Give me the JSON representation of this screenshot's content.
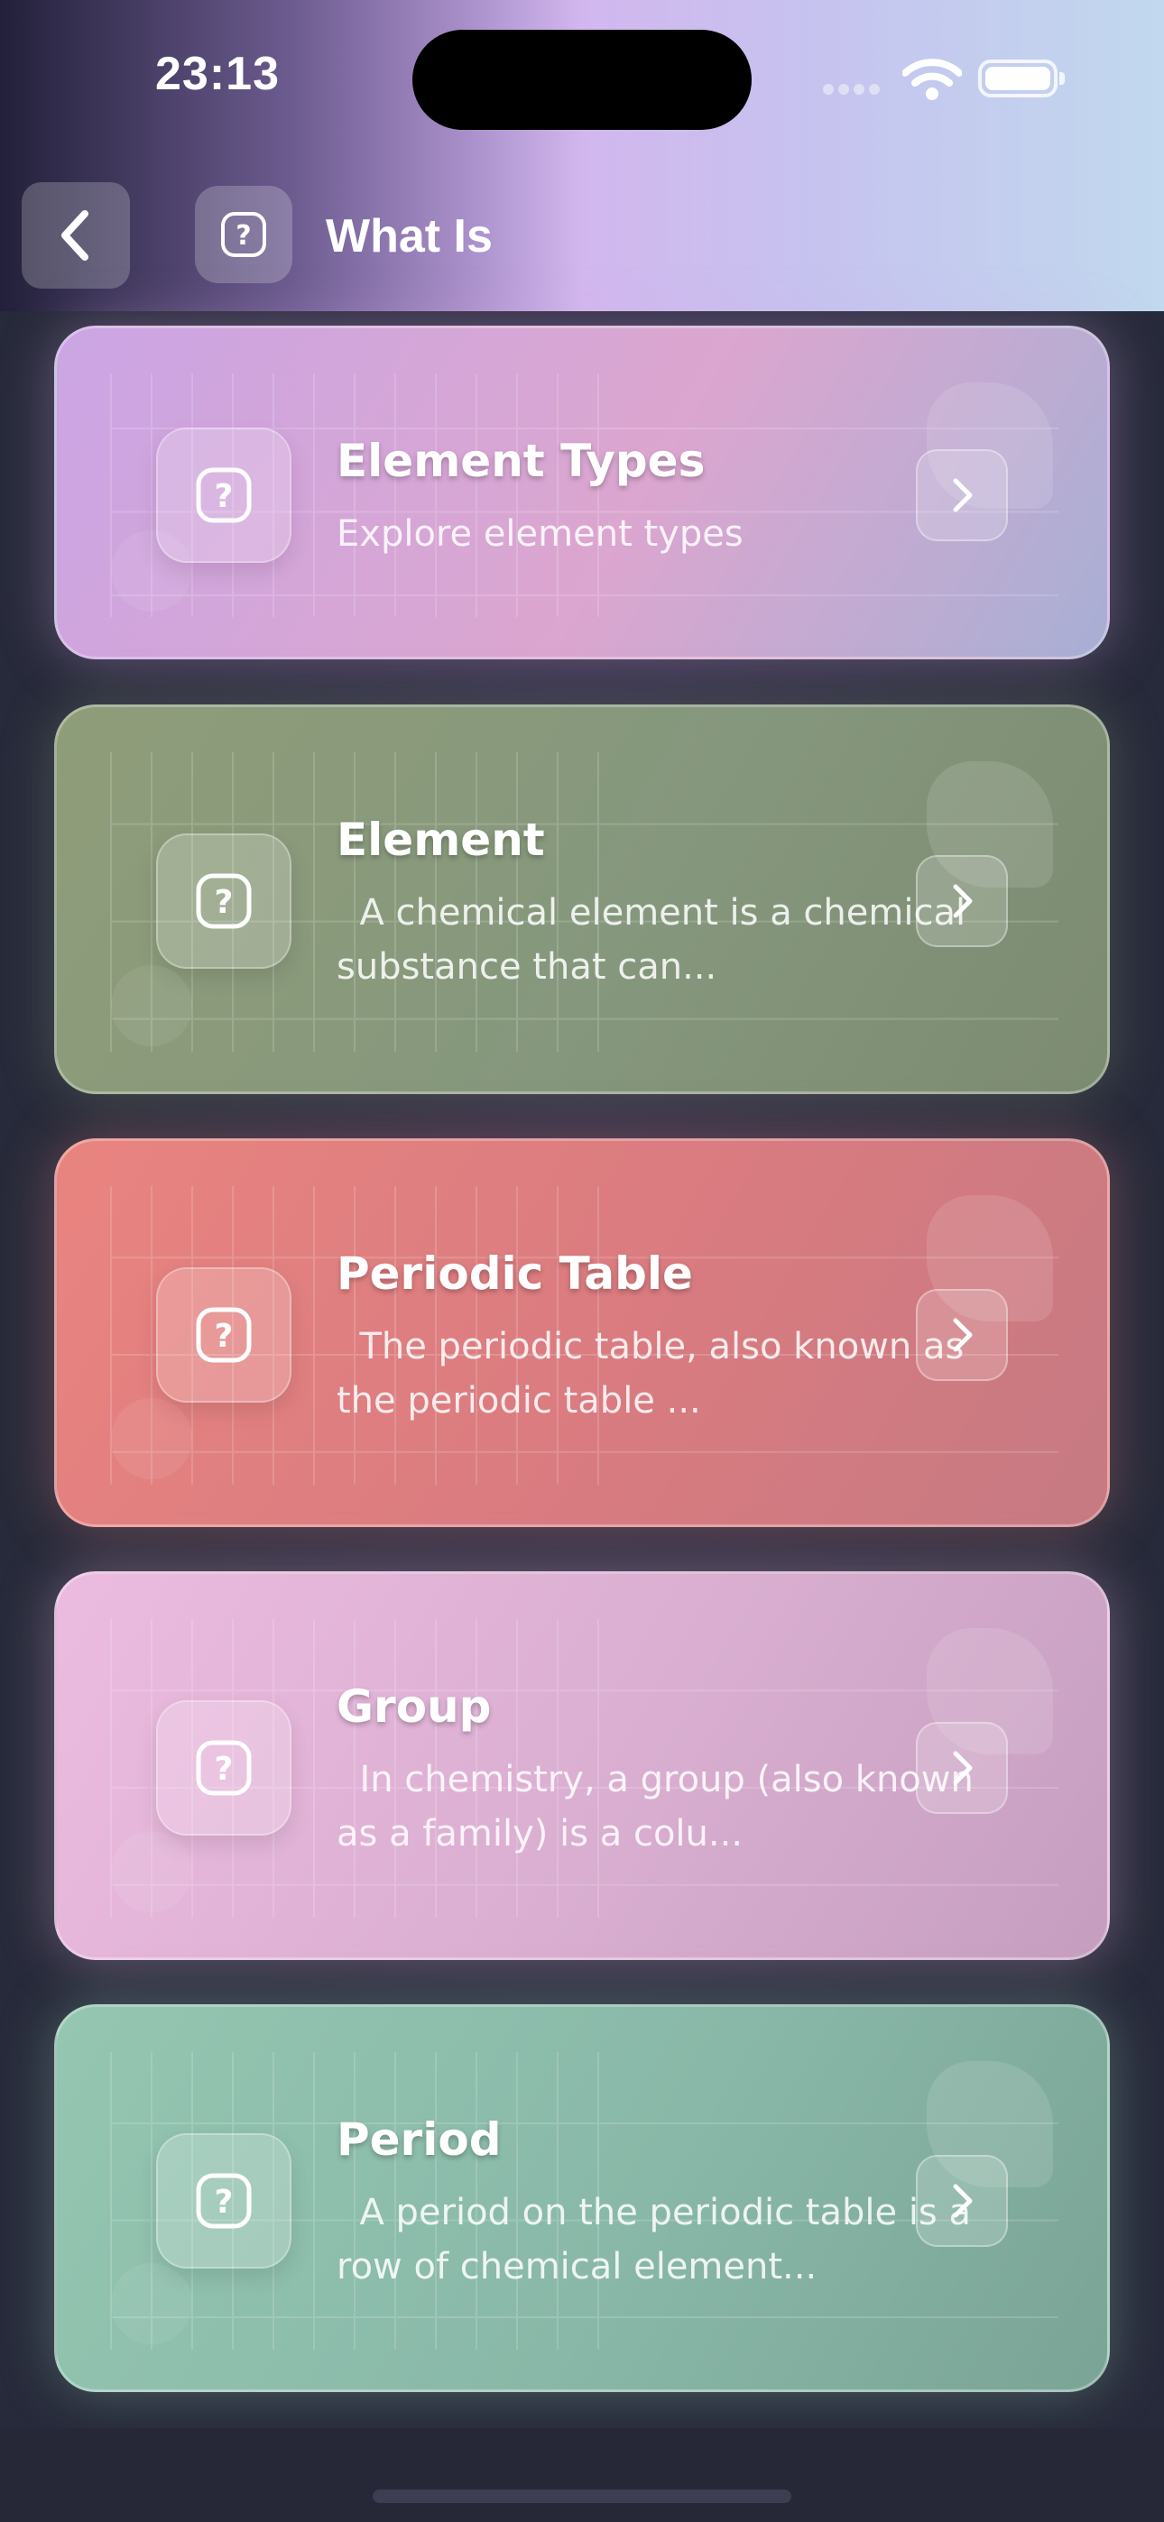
{
  "status_bar": {
    "time": "23:13"
  },
  "header": {
    "title": "What Is"
  },
  "cards": [
    {
      "title": "Element Types",
      "description": "Explore element types",
      "colors": [
        "#cba5e4",
        "#dba6cf",
        "#a8afd4"
      ]
    },
    {
      "title": "Element",
      "description": "  A chemical element is a chemical substance that can...",
      "colors": [
        "#8f9d79",
        "#85977d",
        "#7c8b72"
      ]
    },
    {
      "title": "Periodic Table",
      "description": "  The periodic table, also known as the periodic table ...",
      "colors": [
        "#e98480",
        "#d97b80",
        "#c67a82"
      ]
    },
    {
      "title": "Group",
      "description": "  In chemistry, a group (also known as a family) is a colu...",
      "colors": [
        "#ecbbe0",
        "#d9aed0",
        "#c59ebf"
      ]
    },
    {
      "title": "Period",
      "description": "  A period on the periodic table is a row of chemical element...",
      "colors": [
        "#94c6b1",
        "#89b8a8",
        "#7aa496"
      ]
    }
  ]
}
